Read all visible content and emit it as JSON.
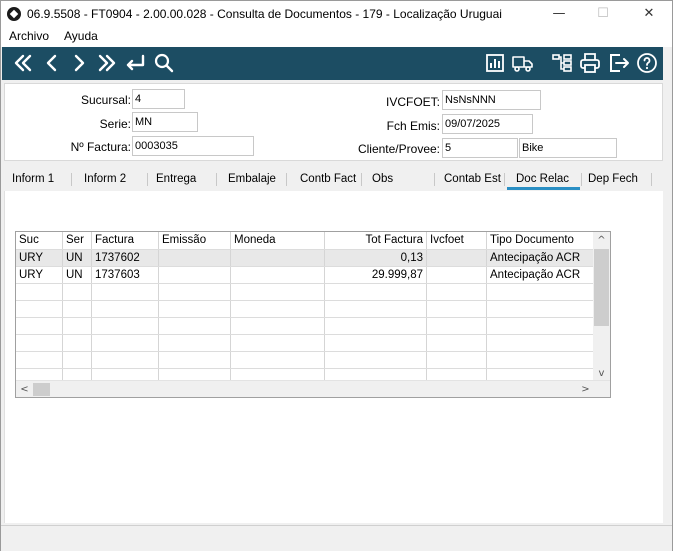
{
  "window": {
    "title": "06.9.5508 - FT0904 - 2.00.00.028 - Consulta de Documentos - 179 - Localização Uruguai",
    "minimize": "—",
    "maximize": "☐",
    "close": "✕"
  },
  "menu": [
    "Archivo",
    "Ayuda"
  ],
  "toolbar": {
    "icons": [
      "first-icon",
      "previous-icon",
      "next-icon",
      "last-icon",
      "return-icon",
      "search-icon",
      "chart-icon",
      "truck-icon",
      "hierarchy-icon",
      "print-icon",
      "exit-icon",
      "help-icon"
    ]
  },
  "header": {
    "sucursal_label": "Sucursal:",
    "sucursal_value": "4",
    "serie_label": "Serie:",
    "serie_value": "MN",
    "factura_label": "Nº Factura:",
    "factura_value": "0003035",
    "ivcfoet_label": "IVCFOET:",
    "ivcfoet_value": "NsNsNNN",
    "fch_emis_label": "Fch Emis:",
    "fch_emis_value": "09/07/2025",
    "cliente_label": "Cliente/Provee:",
    "cliente_code": "5",
    "cliente_name": "Bike"
  },
  "tabs": [
    {
      "label": "Inform 1"
    },
    {
      "label": "Inform 2"
    },
    {
      "label": "Entrega"
    },
    {
      "label": "Embalaje"
    },
    {
      "label": "Contb Fact"
    },
    {
      "label": "Obs"
    },
    {
      "label": "Contab Est"
    },
    {
      "label": "Doc Relac",
      "active": true
    },
    {
      "label": "Dep Fech"
    }
  ],
  "grid": {
    "columns": [
      "Suc",
      "Ser",
      "Factura",
      "Emissão",
      "Moneda",
      "Tot Factura",
      "Ivcfoet",
      "Tipo Documento"
    ],
    "rows": [
      [
        "URY",
        "UN",
        "1737602",
        "",
        "",
        "0,13",
        "",
        "Antecipação ACR"
      ],
      [
        "URY",
        "UN",
        "1737603",
        "",
        "",
        "29.999,87",
        "",
        "Antecipação ACR"
      ]
    ],
    "empty_rows": 6,
    "scroll_left": "<",
    "scroll_right": ">",
    "scroll_up": "^",
    "scroll_down": "v"
  },
  "colors": {
    "toolbar_bg": "#1c4d63",
    "active_tab": "#2a8fc4"
  }
}
